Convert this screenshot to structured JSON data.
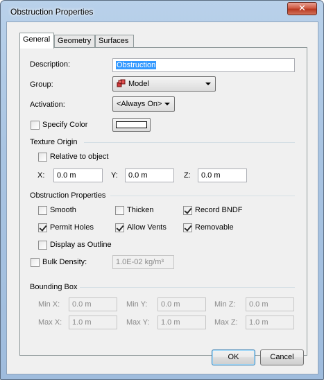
{
  "window": {
    "title": "Obstruction Properties",
    "close_glyph": "✕"
  },
  "tabs": [
    {
      "label": "General",
      "active": true
    },
    {
      "label": "Geometry",
      "active": false
    },
    {
      "label": "Surfaces",
      "active": false
    }
  ],
  "general": {
    "description_label": "Description:",
    "description_value": "Obstruction",
    "group_label": "Group:",
    "group_value": "Model",
    "group_icon": "model-icon",
    "activation_label": "Activation:",
    "activation_value": "<Always On>",
    "specify_color_label": "Specify Color",
    "specify_color_checked": false,
    "color_value": "#ffffff"
  },
  "texture_origin": {
    "title": "Texture Origin",
    "relative_label": "Relative to object",
    "relative_checked": false,
    "x_label": "X:",
    "x_value": "0.0 m",
    "y_label": "Y:",
    "y_value": "0.0 m",
    "z_label": "Z:",
    "z_value": "0.0 m"
  },
  "obstruction_properties": {
    "title": "Obstruction Properties",
    "smooth_label": "Smooth",
    "smooth_checked": false,
    "thicken_label": "Thicken",
    "thicken_checked": false,
    "record_bndf_label": "Record BNDF",
    "record_bndf_checked": true,
    "permit_holes_label": "Permit Holes",
    "permit_holes_checked": true,
    "allow_vents_label": "Allow Vents",
    "allow_vents_checked": true,
    "removable_label": "Removable",
    "removable_checked": true,
    "outline_label": "Display as Outline",
    "outline_checked": false,
    "bulk_density_label": "Bulk Density:",
    "bulk_density_checked": false,
    "bulk_density_value": "1.0E-02 kg/m³"
  },
  "bounding_box": {
    "title": "Bounding Box",
    "min_x_label": "Min X:",
    "min_x_value": "0.0 m",
    "min_y_label": "Min Y:",
    "min_y_value": "0.0 m",
    "min_z_label": "Min Z:",
    "min_z_value": "0.0 m",
    "max_x_label": "Max X:",
    "max_x_value": "1.0 m",
    "max_y_label": "Max Y:",
    "max_y_value": "1.0 m",
    "max_z_label": "Max Z:",
    "max_z_value": "1.0 m"
  },
  "buttons": {
    "ok": "OK",
    "cancel": "Cancel"
  }
}
